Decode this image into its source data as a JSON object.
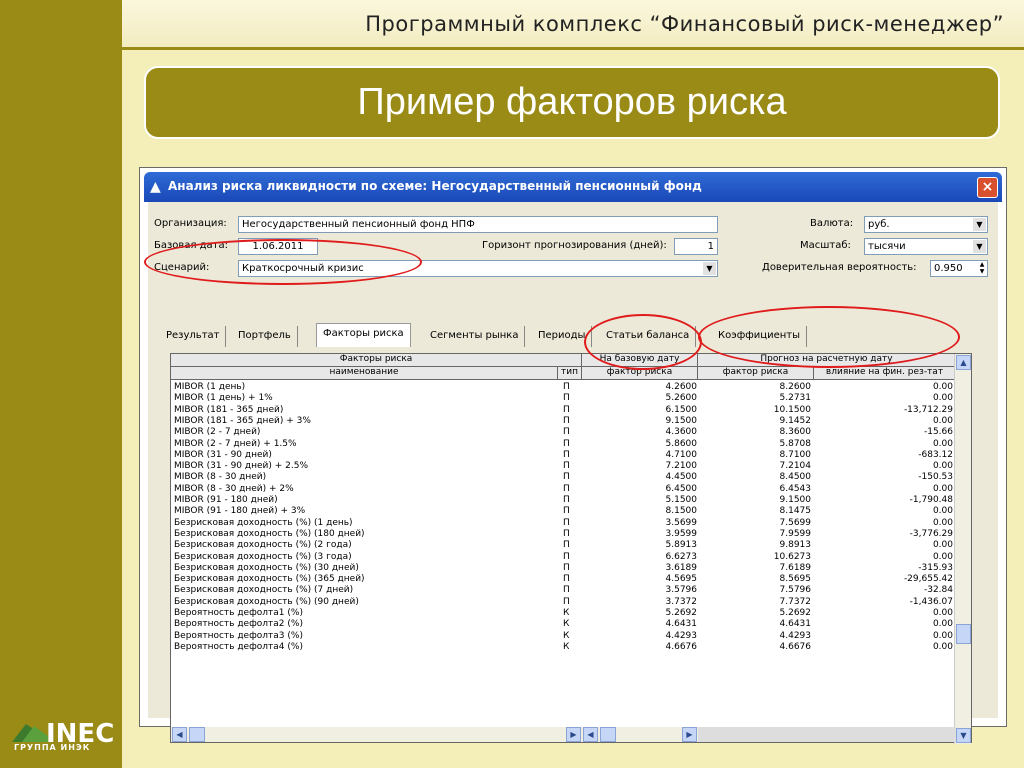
{
  "header": {
    "title": "Программный комплекс “Финансовый риск-менеджер”"
  },
  "slide": {
    "title": "Пример факторов риска"
  },
  "logo": {
    "mark": "INEC",
    "caption": "ГРУППА ИНЭК"
  },
  "window": {
    "title": "Анализ риска ликвидности по схеме: Негосударственный пенсионный фонд",
    "close_label": "×"
  },
  "form": {
    "org_label": "Организация:",
    "org_value": "Негосударственный пенсионный фонд НПФ",
    "date_label": "Базовая дата:",
    "date_value": "1.06.2011",
    "horizon_label": "Горизонт прогнозирования (дней):",
    "horizon_value": "1",
    "scenario_label": "Сценарий:",
    "scenario_value": "Краткосрочный кризис",
    "currency_label": "Валюта:",
    "currency_value": "руб.",
    "scale_label": "Масштаб:",
    "scale_value": "тысячи",
    "confidence_label": "Доверительная вероятность:",
    "confidence_value": "0.950"
  },
  "tabs": [
    "Результат",
    "Портфель",
    "Факторы риска",
    "Сегменты рынка",
    "Периоды",
    "Статьи баланса",
    "Коэффициенты"
  ],
  "active_tab": "Факторы риска",
  "table": {
    "group_headers": {
      "factors": "Факторы риска",
      "base": "На базовую дату",
      "forecast": "Прогноз на расчетную дату"
    },
    "columns": {
      "name": "наименование",
      "type": "тип",
      "base_factor": "фактор риска",
      "fc_factor": "фактор риска",
      "influence": "влияние на фин. рез-тат"
    },
    "rows": [
      [
        "MIBOR  (1 день)",
        "П",
        "4.2600",
        "8.2600",
        "0.00"
      ],
      [
        "MIBOR (1 день) + 1%",
        "П",
        "5.2600",
        "5.2731",
        "0.00"
      ],
      [
        "MIBOR (181 - 365 дней)",
        "П",
        "6.1500",
        "10.1500",
        "-13,712.29"
      ],
      [
        "MIBOR (181 - 365 дней) + 3%",
        "П",
        "9.1500",
        "9.1452",
        "0.00"
      ],
      [
        "MIBOR (2 - 7 дней)",
        "П",
        "4.3600",
        "8.3600",
        "-15.66"
      ],
      [
        "MIBOR (2 - 7 дней) + 1.5%",
        "П",
        "5.8600",
        "5.8708",
        "0.00"
      ],
      [
        "MIBOR (31 - 90 дней)",
        "П",
        "4.7100",
        "8.7100",
        "-683.12"
      ],
      [
        "MIBOR (31 - 90 дней) + 2.5%",
        "П",
        "7.2100",
        "7.2104",
        "0.00"
      ],
      [
        "MIBOR (8 - 30 дней)",
        "П",
        "4.4500",
        "8.4500",
        "-150.53"
      ],
      [
        "MIBOR (8 - 30 дней) + 2%",
        "П",
        "6.4500",
        "6.4543",
        "0.00"
      ],
      [
        "MIBOR (91 - 180 дней)",
        "П",
        "5.1500",
        "9.1500",
        "-1,790.48"
      ],
      [
        "MIBOR (91 - 180 дней) + 3%",
        "П",
        "8.1500",
        "8.1475",
        "0.00"
      ],
      [
        "Безрисковая доходность (%) (1 день)",
        "П",
        "3.5699",
        "7.5699",
        "0.00"
      ],
      [
        "Безрисковая доходность (%) (180 дней)",
        "П",
        "3.9599",
        "7.9599",
        "-3,776.29"
      ],
      [
        "Безрисковая доходность (%) (2 года)",
        "П",
        "5.8913",
        "9.8913",
        "0.00"
      ],
      [
        "Безрисковая доходность (%) (3 года)",
        "П",
        "6.6273",
        "10.6273",
        "0.00"
      ],
      [
        "Безрисковая доходность (%) (30 дней)",
        "П",
        "3.6189",
        "7.6189",
        "-315.93"
      ],
      [
        "Безрисковая доходность (%) (365 дней)",
        "П",
        "4.5695",
        "8.5695",
        "-29,655.42"
      ],
      [
        "Безрисковая доходность (%) (7 дней)",
        "П",
        "3.5796",
        "7.5796",
        "-32.84"
      ],
      [
        "Безрисковая доходность (%) (90 дней)",
        "П",
        "3.7372",
        "7.7372",
        "-1,436.07"
      ],
      [
        "Вероятность дефолта1 (%)",
        "К",
        "5.2692",
        "5.2692",
        "0.00"
      ],
      [
        "Вероятность дефолта2 (%)",
        "К",
        "4.6431",
        "4.6431",
        "0.00"
      ],
      [
        "Вероятность дефолта3 (%)",
        "К",
        "4.4293",
        "4.4293",
        "0.00"
      ],
      [
        "Вероятность дефолта4 (%)",
        "К",
        "4.6676",
        "4.6676",
        "0.00"
      ]
    ]
  },
  "colors": {
    "olive": "#9a8a16",
    "cream": "#f4eeb9",
    "highlight": "#e01b1b",
    "titlebar": "#1a48b8"
  }
}
